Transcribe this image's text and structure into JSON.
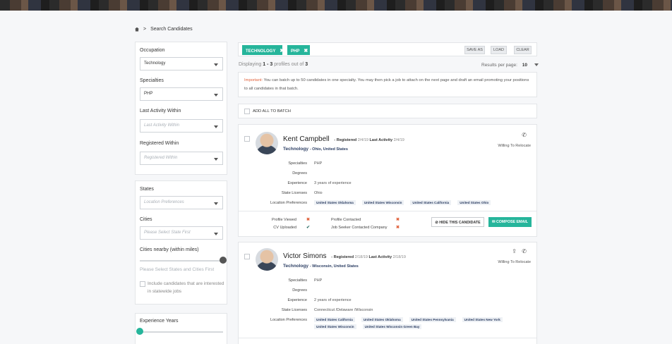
{
  "breadcrumb": {
    "current": "Search Candidates"
  },
  "filters": {
    "occupation": {
      "label": "Occupation",
      "value": "Technology"
    },
    "specialties": {
      "label": "Specialties",
      "value": "PHP"
    },
    "last_activity": {
      "label": "Last Activity Within",
      "placeholder": "Last Activity Within"
    },
    "registered": {
      "label": "Registered Within",
      "placeholder": "Registered Within"
    },
    "states": {
      "label": "States",
      "placeholder": "Location Preferences"
    },
    "cities": {
      "label": "Cities",
      "placeholder": "Please Select State First"
    },
    "nearby": {
      "label": "Cities nearby (within miles)",
      "hint": "Please Select States and Cities First"
    },
    "statewide": {
      "label": "Include candidates that are interested in statewide jobs"
    },
    "experience": {
      "label": "Experience Years"
    }
  },
  "tags": [
    {
      "label": "TECHNOLOGY"
    },
    {
      "label": "PHP"
    }
  ],
  "toolbar": {
    "save_as": "SAVE AS",
    "load": "LOAD",
    "clear": "CLEAR"
  },
  "results": {
    "prefix": "Displaying",
    "range": "1 - 3",
    "middle": "profiles out of",
    "total": "3",
    "per_page_label": "Results per page:",
    "per_page_value": "10"
  },
  "notice": {
    "important": "Important:",
    "text": "You can batch up to 50 candidates in one specialty. You may then pick a job to attach on the next page and draft an email promoting your positions to all candidates in that batch."
  },
  "add_all_label": "ADD ALL TO BATCH",
  "labels": {
    "registered": "- Registered",
    "last_activity": "Last Activity",
    "specialties": "Specialties",
    "degrees": "Degrees",
    "experience": "Experience",
    "state_licenses": "State Licenses",
    "location_prefs": "Location Preferences",
    "willing": "Willing To Relocate",
    "profile_viewed": "Profile Viewed",
    "cv_uploaded": "CV Uploaded",
    "profile_contacted": "Profile Contacted",
    "job_seeker_contacted": "Job Seeker Contacted Company",
    "hide": "HIDE THIS CANDIDATE",
    "compose": "COMPOSE EMAIL"
  },
  "candidates": [
    {
      "name": "Kent Campbell",
      "registered": "2/4/19",
      "last_activity": "2/4/19",
      "occupation": "Technology",
      "location": "- Ohio, United States",
      "specialties": "PHP",
      "degrees": "",
      "experience": "3 years of experience",
      "state_licenses": "Ohio",
      "location_prefs": [
        "United States Oklahoma",
        "United States Wisconsin",
        "United States California",
        "United States Ohio"
      ]
    },
    {
      "name": "Victor Simons",
      "registered": "2/18/19",
      "last_activity": "2/18/19",
      "occupation": "Technology",
      "location": "- Wisconsin, United States",
      "specialties": "PHP",
      "degrees": "",
      "experience": "2 years of experience",
      "state_licenses": "Connecticut /Delaware /Wisconsin",
      "location_prefs": [
        "United States California",
        "United States Oklahoma",
        "United States Pennsylvania",
        "United States New York",
        "United States Wisconsin",
        "United States Wisconsin Green Bay"
      ]
    }
  ],
  "colors": {
    "accent": "#26b59b",
    "navy": "#2c3e63",
    "danger": "#e0613b",
    "slider_knob": "#555555"
  }
}
